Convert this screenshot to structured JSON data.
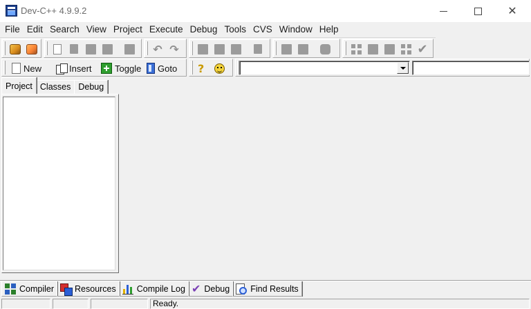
{
  "window": {
    "title": "Dev-C++ 4.9.9.2"
  },
  "menu": [
    "File",
    "Edit",
    "Search",
    "View",
    "Project",
    "Execute",
    "Debug",
    "Tools",
    "CVS",
    "Window",
    "Help"
  ],
  "toolbar2": {
    "new_label": "New",
    "insert_label": "Insert",
    "toggle_label": "Toggle",
    "goto_label": "Goto",
    "help_glyph": "?"
  },
  "left_tabs": [
    "Project",
    "Classes",
    "Debug"
  ],
  "bottom_tabs": [
    "Compiler",
    "Resources",
    "Compile Log",
    "Debug",
    "Find Results"
  ],
  "status": {
    "message": "Ready."
  },
  "icons": {
    "close": "✕",
    "check": "✔",
    "undo": "↶",
    "redo": "↷",
    "debug_check": "✔"
  }
}
